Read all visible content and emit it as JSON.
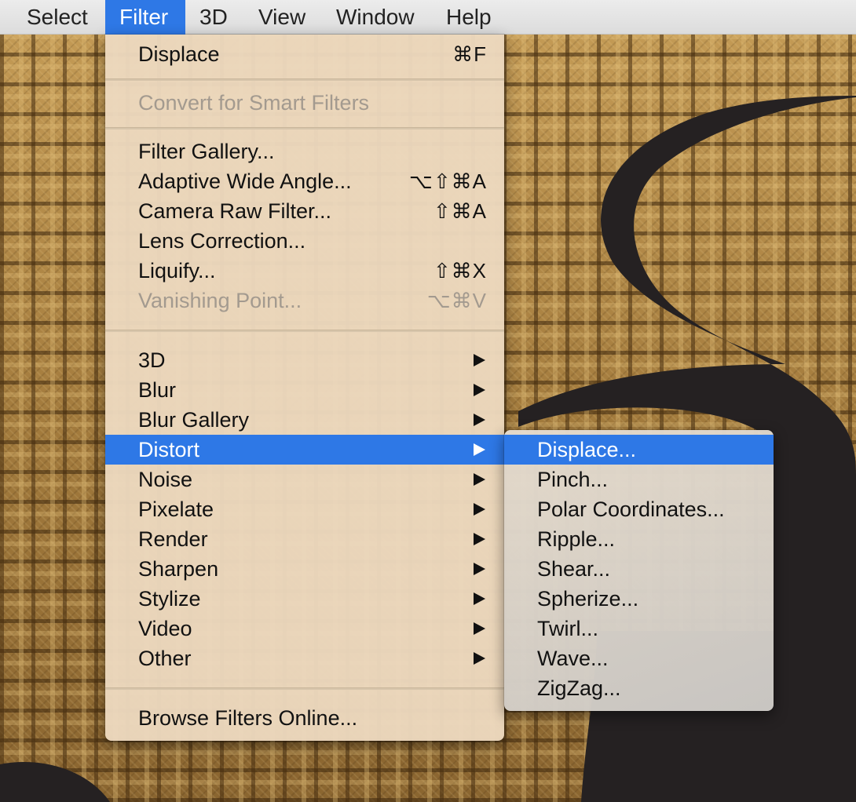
{
  "menubar": {
    "items": [
      {
        "label": "Select"
      },
      {
        "label": "Filter"
      },
      {
        "label": "3D"
      },
      {
        "label": "View"
      },
      {
        "label": "Window"
      },
      {
        "label": "Help"
      }
    ],
    "active": "Filter"
  },
  "filter_menu": {
    "last_filter": {
      "label": "Displace",
      "shortcut": "⌘F"
    },
    "convert_smart": {
      "label": "Convert for Smart Filters",
      "enabled": false
    },
    "filter_gallery": {
      "label": "Filter Gallery..."
    },
    "adaptive_wide_angle": {
      "label": "Adaptive Wide Angle...",
      "shortcut": "⌥⇧⌘A"
    },
    "camera_raw": {
      "label": "Camera Raw Filter...",
      "shortcut": "⇧⌘A"
    },
    "lens_correction": {
      "label": "Lens Correction..."
    },
    "liquify": {
      "label": "Liquify...",
      "shortcut": "⇧⌘X"
    },
    "vanishing_point": {
      "label": "Vanishing Point...",
      "shortcut": "⌥⌘V",
      "enabled": false
    },
    "submenus": [
      {
        "label": "3D"
      },
      {
        "label": "Blur"
      },
      {
        "label": "Blur Gallery"
      },
      {
        "label": "Distort",
        "selected": true
      },
      {
        "label": "Noise"
      },
      {
        "label": "Pixelate"
      },
      {
        "label": "Render"
      },
      {
        "label": "Sharpen"
      },
      {
        "label": "Stylize"
      },
      {
        "label": "Video"
      },
      {
        "label": "Other"
      }
    ],
    "browse_online": {
      "label": "Browse Filters Online..."
    }
  },
  "distort_submenu": {
    "items": [
      {
        "label": "Displace...",
        "selected": true
      },
      {
        "label": "Pinch..."
      },
      {
        "label": "Polar Coordinates..."
      },
      {
        "label": "Ripple..."
      },
      {
        "label": "Shear..."
      },
      {
        "label": "Spherize..."
      },
      {
        "label": "Twirl..."
      },
      {
        "label": "Wave..."
      },
      {
        "label": "ZigZag..."
      }
    ]
  },
  "colors": {
    "accent": "#2e78e6",
    "menu_bg": "#ecd8be",
    "disabled_text": "#a39a8f",
    "canvas_shape": "#252122",
    "burlap": "#b08a4a"
  },
  "icons": {
    "submenu_arrow": "triangle-right-icon"
  }
}
